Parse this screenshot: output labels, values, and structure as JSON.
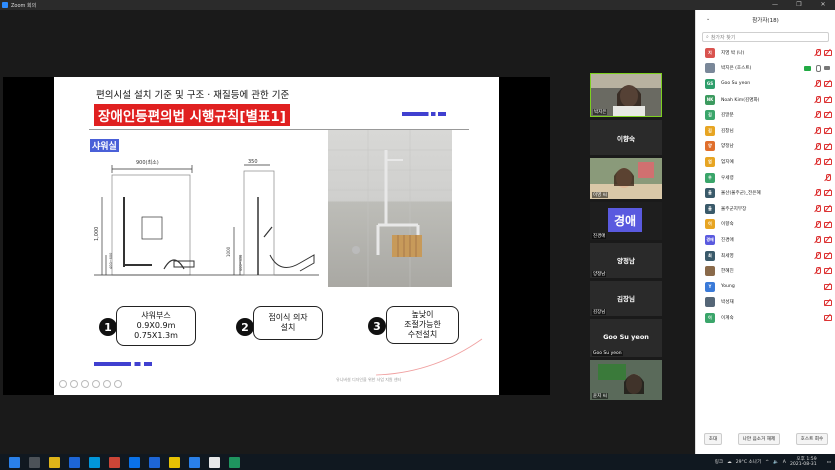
{
  "window": {
    "title": "Zoom 회의",
    "controls": [
      "—",
      "❐",
      "✕"
    ]
  },
  "slide": {
    "title1": "편의시설 설치 기준 및 구조 · 재질등에 관한 기준",
    "title2": "장애인등편의법 시행규칙[별표1]",
    "section": "샤워실",
    "dims": {
      "width_label": "900(최소)",
      "top_label": "350",
      "height_label": "1,000",
      "low_label": "400~600",
      "side_label": "1000",
      "bottom_label": "400~450"
    },
    "items": [
      {
        "number": "1",
        "lines": [
          "샤워부스",
          "0.9X0.9m",
          "0.75X1.3m"
        ]
      },
      {
        "number": "2",
        "lines": [
          "접이식 의자",
          "설치"
        ]
      },
      {
        "number": "3",
        "lines": [
          "높낮이",
          "조절가능한",
          "수전설치"
        ]
      }
    ],
    "footer": "유니버설 디자인을 위한 사업 지원 센터"
  },
  "gallery": [
    {
      "name": "박지은",
      "type": "video"
    },
    {
      "name": "",
      "center": "이향숙",
      "type": "name"
    },
    {
      "name": "이영 씨",
      "type": "video"
    },
    {
      "name": "진경애",
      "center": "경애",
      "type": "avatar"
    },
    {
      "name": "양정남",
      "center": "양정남",
      "type": "name"
    },
    {
      "name": "김장님",
      "center": "김장님",
      "type": "name"
    },
    {
      "name": "Goo Su yeon",
      "center": "Goo Su yeon",
      "type": "name"
    },
    {
      "name": "윤지 씨",
      "type": "video"
    }
  ],
  "panel": {
    "title": "참가자(18)",
    "search_placeholder": "참가자 찾기",
    "participants": [
      {
        "name": "지영 박 (나)",
        "avatar": "지",
        "color": "#d9534f",
        "icons": [
          "mic-off",
          "cam-off"
        ]
      },
      {
        "name": "박지은 (호스트)",
        "avatar": "",
        "color": "#7a8899",
        "icons": [
          "share",
          "mic-on",
          "cam-on"
        ]
      },
      {
        "name": "Goo Su yeon",
        "avatar": "GS",
        "color": "#2e9e6b",
        "icons": [
          "mic-off",
          "cam-off"
        ]
      },
      {
        "name": "Noah Kim(김명화)",
        "avatar": "NK",
        "color": "#3c9a5f",
        "icons": [
          "mic-off",
          "cam-off"
        ]
      },
      {
        "name": "김말분",
        "avatar": "김",
        "color": "#3aa56a",
        "icons": [
          "mic-off",
          "cam-off"
        ]
      },
      {
        "name": "김창님",
        "avatar": "김",
        "color": "#e7a523",
        "icons": [
          "mic-off",
          "cam-off"
        ]
      },
      {
        "name": "양정남",
        "avatar": "양",
        "color": "#e06f2c",
        "icons": [
          "mic-off",
          "cam-off"
        ]
      },
      {
        "name": "엄지예",
        "avatar": "엄",
        "color": "#e7a523",
        "icons": [
          "mic-off",
          "cam-off"
        ]
      },
      {
        "name": "우세령",
        "avatar": "우",
        "color": "#3aa56a",
        "icons": [
          "mic-off"
        ]
      },
      {
        "name": "울산(울주군)_전은혜",
        "avatar": "울",
        "color": "#3a5a6a",
        "icons": [
          "mic-off",
          "cam-off"
        ]
      },
      {
        "name": "울주군지부장",
        "avatar": "울",
        "color": "#3a5a6a",
        "icons": [
          "mic-off",
          "cam-off"
        ]
      },
      {
        "name": "이향숙",
        "avatar": "이",
        "color": "#e7a523",
        "icons": [
          "mic-off",
          "cam-off"
        ]
      },
      {
        "name": "진경애",
        "avatar": "경애",
        "color": "#5a5adf",
        "icons": [
          "mic-off",
          "cam-off"
        ]
      },
      {
        "name": "최세영",
        "avatar": "최",
        "color": "#3a5a6a",
        "icons": [
          "mic-off",
          "cam-off"
        ]
      },
      {
        "name": "한혜진",
        "avatar": "",
        "color": "#8a6a4a",
        "icons": [
          "mic-off",
          "cam-off"
        ]
      },
      {
        "name": "Young",
        "avatar": "Y",
        "color": "#3a7ad8",
        "icons": [
          "cam-off"
        ]
      },
      {
        "name": "박성재",
        "avatar": "",
        "color": "#556677",
        "icons": [
          "cam-off"
        ]
      },
      {
        "name": "이계숙",
        "avatar": "이",
        "color": "#3aa56a",
        "icons": [
          "cam-off"
        ]
      }
    ],
    "footer_buttons": [
      "초대",
      "나만 음소거 해제",
      "호스트 회수"
    ]
  },
  "taskbar": {
    "apps": [
      "#2d8cff",
      "#ffffff",
      "#f5c518",
      "#1f6feb",
      "#00a4ef",
      "#e04a3a",
      "#0a7cff",
      "#1f6feb",
      "#ffd500",
      "#2d8cff",
      "#ffffff",
      "#21a366"
    ],
    "tray_label": "링크",
    "weather": "29°C 소나기",
    "ime": "A",
    "time": "오후 1:59",
    "date": "2021-08-31"
  }
}
